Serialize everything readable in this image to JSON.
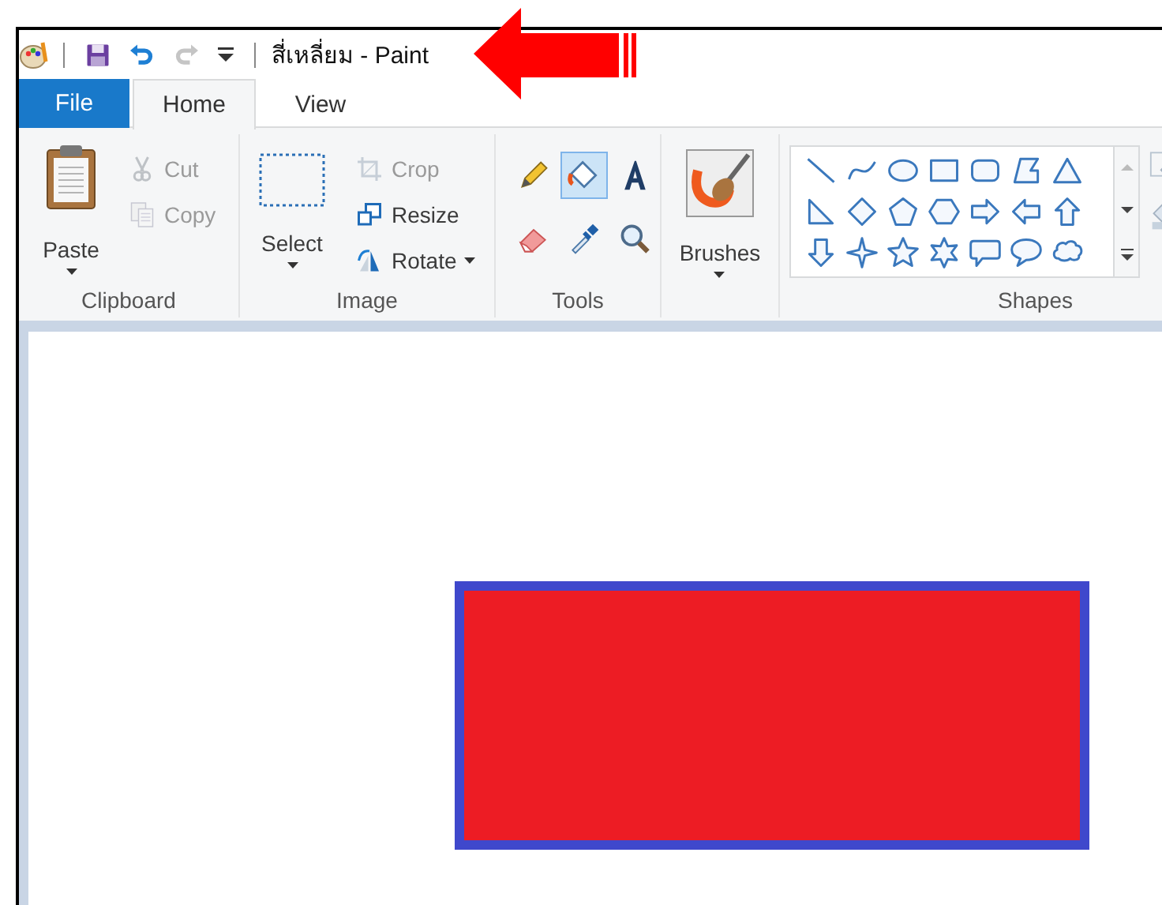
{
  "window": {
    "title": "สี่เหลี่ยม - Paint"
  },
  "quick_access": [
    {
      "kind": "save",
      "disabled": false
    },
    {
      "kind": "undo",
      "disabled": false
    },
    {
      "kind": "redo",
      "disabled": true
    },
    {
      "kind": "customize",
      "disabled": false
    }
  ],
  "tabs": [
    {
      "label": "File",
      "kind": "file",
      "selected": false
    },
    {
      "label": "Home",
      "kind": "tab",
      "selected": true
    },
    {
      "label": "View",
      "kind": "tab",
      "selected": false
    }
  ],
  "ribbon": {
    "groups": [
      {
        "label": "Clipboard",
        "kind": "clipboard",
        "large": {
          "label": "Paste",
          "kind": "paste"
        },
        "small": [
          {
            "label": "Cut",
            "kind": "cut",
            "disabled": true,
            "dropdown": false
          },
          {
            "label": "Copy",
            "kind": "copy",
            "disabled": true,
            "dropdown": false
          }
        ]
      },
      {
        "label": "Image",
        "kind": "image",
        "large": {
          "label": "Select",
          "kind": "select"
        },
        "small": [
          {
            "label": "Crop",
            "kind": "crop",
            "disabled": true,
            "dropdown": false
          },
          {
            "label": "Resize",
            "kind": "resize",
            "disabled": false,
            "dropdown": false
          },
          {
            "label": "Rotate",
            "kind": "rotate",
            "disabled": false,
            "dropdown": true
          }
        ]
      },
      {
        "label": "Tools",
        "kind": "tools",
        "tools": [
          {
            "kind": "pencil",
            "selected": false
          },
          {
            "kind": "fill",
            "selected": true
          },
          {
            "kind": "text",
            "selected": false
          },
          {
            "kind": "eraser",
            "selected": false
          },
          {
            "kind": "picker",
            "selected": false
          },
          {
            "kind": "magnifier",
            "selected": false
          }
        ]
      },
      {
        "kind": "brushes",
        "large": {
          "label": "Brushes",
          "kind": "brushes"
        }
      },
      {
        "label": "Shapes",
        "kind": "shapes",
        "shapes": [
          {
            "kind": "line"
          },
          {
            "kind": "curve"
          },
          {
            "kind": "oval"
          },
          {
            "kind": "rectangle"
          },
          {
            "kind": "rounded-rectangle"
          },
          {
            "kind": "polygon"
          },
          {
            "kind": "triangle"
          },
          {
            "kind": "right-triangle"
          },
          {
            "kind": "diamond"
          },
          {
            "kind": "pentagon"
          },
          {
            "kind": "hexagon"
          },
          {
            "kind": "right-arrow"
          },
          {
            "kind": "left-arrow"
          },
          {
            "kind": "up-arrow"
          },
          {
            "kind": "down-arrow"
          },
          {
            "kind": "four-point-star"
          },
          {
            "kind": "five-point-star"
          },
          {
            "kind": "six-point-star"
          },
          {
            "kind": "rounded-callout"
          },
          {
            "kind": "oval-callout"
          },
          {
            "kind": "cloud-callout"
          }
        ]
      }
    ]
  },
  "canvas": {
    "shapes": [
      {
        "kind": "rectangle"
      }
    ]
  },
  "annotation": {
    "kind": "arrow"
  }
}
